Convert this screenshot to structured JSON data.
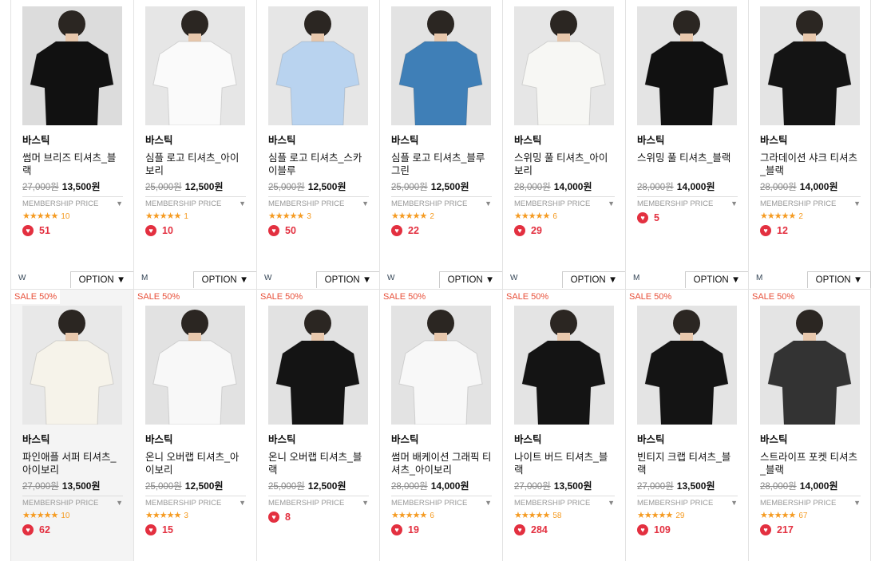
{
  "option_label": "OPTION ▼",
  "membership_label": "MEMBERSHIP PRICE",
  "membership_arrow": "▼",
  "sale_badge": "SALE 50%",
  "rows": [
    [
      {
        "brand": "바스틱",
        "name": "썸머 브리즈 티셔츠_블랙",
        "orig": "27,000원",
        "price": "13,500원",
        "stars": "★★★★★",
        "rating": 4.5,
        "reviews": "10",
        "likes": "51",
        "gender": "W",
        "colors": {
          "bg": "#dcdcdc",
          "shirt": "#111111"
        }
      },
      {
        "brand": "바스틱",
        "name": "심플 로고 티셔츠_아이보리",
        "orig": "25,000원",
        "price": "12,500원",
        "stars": "★★★★★",
        "rating": 5,
        "reviews": "1",
        "likes": "10",
        "gender": "M",
        "colors": {
          "bg": "#e6e6e6",
          "shirt": "#fafafa"
        }
      },
      {
        "brand": "바스틱",
        "name": "심플 로고 티셔츠_스카이블루",
        "orig": "25,000원",
        "price": "12,500원",
        "stars": "★★★★★",
        "rating": 4,
        "reviews": "3",
        "likes": "50",
        "gender": "W",
        "colors": {
          "bg": "#e6e6e6",
          "shirt": "#b9d3ef"
        }
      },
      {
        "brand": "바스틱",
        "name": "심플 로고 티셔츠_블루그린",
        "orig": "25,000원",
        "price": "12,500원",
        "stars": "★★★★★",
        "rating": 4.5,
        "reviews": "2",
        "likes": "22",
        "gender": "W",
        "colors": {
          "bg": "#e3e3e3",
          "shirt": "#3f7fb7"
        }
      },
      {
        "brand": "바스틱",
        "name": "스위밍 풀 티셔츠_아이보리",
        "orig": "28,000원",
        "price": "14,000원",
        "stars": "★★★★★",
        "rating": 4.5,
        "reviews": "6",
        "likes": "29",
        "gender": "W",
        "colors": {
          "bg": "#e6e6e6",
          "shirt": "#f7f7f4"
        }
      },
      {
        "brand": "바스틱",
        "name": "스위밍 풀 티셔츠_블랙",
        "orig": "28,000원",
        "price": "14,000원",
        "stars": "",
        "rating": 0,
        "reviews": "",
        "likes": "5",
        "gender": "M",
        "colors": {
          "bg": "#e4e4e4",
          "shirt": "#111111"
        }
      },
      {
        "brand": "바스틱",
        "name": "그라데이션 샤크 티셔츠_블랙",
        "orig": "28,000원",
        "price": "14,000원",
        "stars": "★★★★★",
        "rating": 4,
        "reviews": "2",
        "likes": "12",
        "gender": "M",
        "colors": {
          "bg": "#e4e4e4",
          "shirt": "#141414"
        }
      }
    ],
    [
      {
        "brand": "바스틱",
        "name": "파인애플 서퍼 티셔츠_아이보리",
        "orig": "27,000원",
        "price": "13,500원",
        "stars": "★★★★★",
        "rating": 4.5,
        "reviews": "10",
        "likes": "62",
        "dim": true,
        "colors": {
          "bg": "#e8e8e8",
          "shirt": "#f6f3ea"
        }
      },
      {
        "brand": "바스틱",
        "name": "온니 오버랩 티셔츠_아이보리",
        "orig": "25,000원",
        "price": "12,500원",
        "stars": "★★★★★",
        "rating": 4.5,
        "reviews": "3",
        "likes": "15",
        "colors": {
          "bg": "#e2e2e2",
          "shirt": "#f8f8f8"
        }
      },
      {
        "brand": "바스틱",
        "name": "온니 오버랩 티셔츠_블랙",
        "orig": "25,000원",
        "price": "12,500원",
        "stars": "",
        "rating": 0,
        "reviews": "",
        "likes": "8",
        "colors": {
          "bg": "#e2e2e2",
          "shirt": "#141414"
        }
      },
      {
        "brand": "바스틱",
        "name": "썸머 배케이션 그래픽 티셔츠_아이보리",
        "orig": "28,000원",
        "price": "14,000원",
        "stars": "★★★★★",
        "rating": 5,
        "reviews": "6",
        "likes": "19",
        "colors": {
          "bg": "#e3e3e3",
          "shirt": "#f8f8f8"
        }
      },
      {
        "brand": "바스틱",
        "name": "나이트 버드 티셔츠_블랙",
        "orig": "27,000원",
        "price": "13,500원",
        "stars": "★★★★★",
        "rating": 5,
        "reviews": "58",
        "likes": "284",
        "colors": {
          "bg": "#e4e4e4",
          "shirt": "#141414"
        }
      },
      {
        "brand": "바스틱",
        "name": "빈티지 크랩 티셔츠_블랙",
        "orig": "27,000원",
        "price": "13,500원",
        "stars": "★★★★★",
        "rating": 5,
        "reviews": "29",
        "likes": "109",
        "colors": {
          "bg": "#e4e4e4",
          "shirt": "#141414"
        }
      },
      {
        "brand": "바스틱",
        "name": "스트라이프 포켓 티셔츠_블랙",
        "orig": "28,000원",
        "price": "14,000원",
        "stars": "★★★★★",
        "rating": 4.5,
        "reviews": "67",
        "likes": "217",
        "colors": {
          "bg": "#e4e4e4",
          "shirt": "#333333"
        }
      }
    ]
  ]
}
